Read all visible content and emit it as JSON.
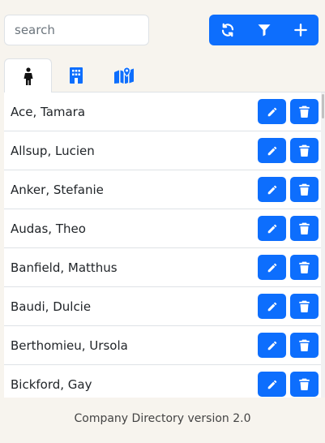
{
  "search": {
    "placeholder": "search",
    "value": ""
  },
  "toolbar": {
    "buttons": [
      {
        "icon": "refresh-icon"
      },
      {
        "icon": "filter-icon"
      },
      {
        "icon": "plus-icon"
      }
    ]
  },
  "tabs": [
    {
      "icon": "person-icon",
      "active": true
    },
    {
      "icon": "building-icon",
      "active": false
    },
    {
      "icon": "map-marker-icon",
      "active": false
    }
  ],
  "list": {
    "rows": [
      {
        "name": "Ace, Tamara"
      },
      {
        "name": "Allsup, Lucien"
      },
      {
        "name": "Anker, Stefanie"
      },
      {
        "name": "Audas, Theo"
      },
      {
        "name": "Banfield, Matthus"
      },
      {
        "name": "Baudi, Dulcie"
      },
      {
        "name": "Berthomieu, Ursola"
      },
      {
        "name": "Bickford, Gay"
      }
    ]
  },
  "footer": {
    "text": "Company Directory version 2.0"
  },
  "colors": {
    "accent": "#0d6efd",
    "background": "#f7f4ee",
    "icon_active": "#111111"
  }
}
